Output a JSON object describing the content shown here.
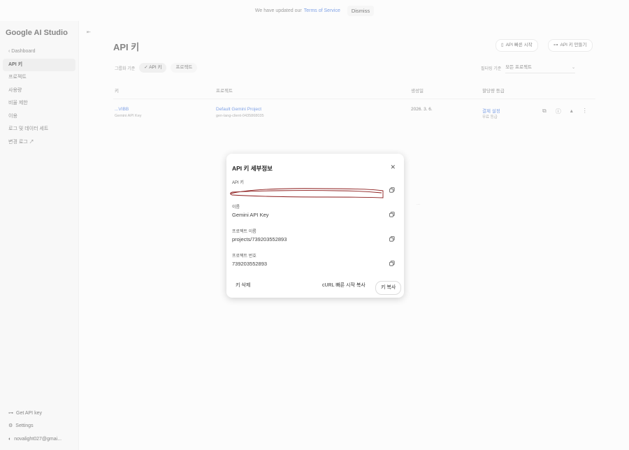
{
  "banner": {
    "text": "We have updated our",
    "link": "Terms of Service",
    "dismiss": "Dismiss"
  },
  "sidebar": {
    "brand": "Google AI Studio",
    "items": [
      {
        "label": "‹ Dashboard"
      },
      {
        "label": "API 키"
      },
      {
        "label": "프로젝트"
      },
      {
        "label": "사용량"
      },
      {
        "label": "비율 제한"
      },
      {
        "label": "이용"
      },
      {
        "label": "로그 및 데이터 세트"
      },
      {
        "label": "변경 로그 ↗"
      }
    ],
    "bottom": [
      {
        "label": "Get API key"
      },
      {
        "label": "Settings"
      },
      {
        "label": "novalight027@gmai..."
      }
    ]
  },
  "header": {
    "title": "API 키",
    "quickstart": "API 빠른 시작",
    "create": "API 키 만들기"
  },
  "filters": {
    "group_label": "그룹화 기준",
    "chips": [
      "API 키",
      "프로젝트"
    ],
    "sort_label": "필터링 기준",
    "sort_value": "모든 프로젝트"
  },
  "table": {
    "headers": [
      "키",
      "프로젝트",
      "생성일",
      "할당량 등급"
    ],
    "rows": [
      {
        "key": "...VIBB",
        "key_name": "Gemini API Key",
        "project": "Default Gemini Project",
        "project_id": "gen-lang-client-0435868035",
        "created": "2026. 3. 6.",
        "tier": "결제 설정",
        "tier_sub": "무료 등급"
      }
    ]
  },
  "modal": {
    "title": "API 키 세부정보",
    "api_key_label": "API 키",
    "name_label": "이름",
    "name_value": "Gemini API Key",
    "project_name_label": "프로젝트 이름",
    "project_name_value": "projects/739203552893",
    "project_number_label": "프로젝트 번호",
    "project_number_value": "739203552893",
    "delete": "키 삭제",
    "curl": "cURL 빠른 시작 복사",
    "copy": "키 복사"
  },
  "colors": {
    "link": "#3b6fd8",
    "scribble": "#8b1a1a"
  }
}
